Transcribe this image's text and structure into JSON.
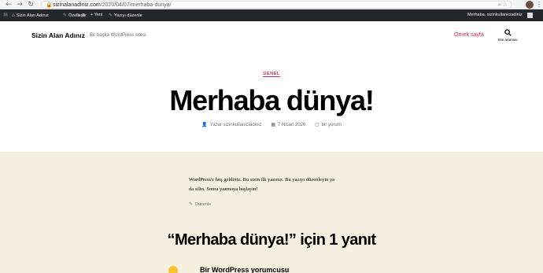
{
  "browser": {
    "url_domain": "sizinalanadiniz.com",
    "url_path": "/2020/04/07/merhaba-dunya/"
  },
  "adminbar": {
    "site_name": "Sizin Alan Adınız",
    "customize": "Özelleştir",
    "comments_count": "0",
    "new": "+ Yeni",
    "edit_post": "Yazıyı düzenle",
    "greeting": "Merhaba, sizinkullaniciadiniz"
  },
  "header": {
    "site_title": "Sizin Alan Adınız",
    "site_description": "Bir başka WordPress sitesi",
    "menu_item": "Örnek sayfa",
    "search_label": "Site araması"
  },
  "post": {
    "category": "GENEL",
    "title": "Merhaba dünya!",
    "author": "Yazar sizinkullaniciadiniz",
    "date": "7 Nisan 2020",
    "comments": "bir yorum",
    "body_line1": "WordPress'e hoş geldiniz. Bu sizin ilk yazınız. Bu yazıyı düzenleyin ya",
    "body_line2": "da silin. Sonra yazmaya başlayın!",
    "edit_label": "Düzenle"
  },
  "comments": {
    "title": "“Merhaba dünya!” için 1 yanıt",
    "author": "Bir WordPress yorumcusu"
  },
  "colors": {
    "accent": "#cd2653",
    "content_bg": "#f5efe0",
    "adminbar_bg": "#23282d"
  }
}
